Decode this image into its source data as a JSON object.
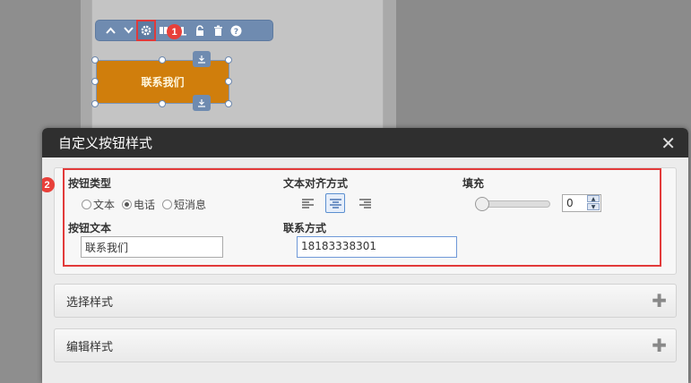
{
  "toolbar": {
    "icons": [
      "chevron-up-icon",
      "chevron-down-icon",
      "gear-icon",
      "layers-icon",
      "chart-icon",
      "unlock-icon",
      "trash-icon",
      "help-icon"
    ]
  },
  "markers": {
    "first": "1",
    "second": "2"
  },
  "canvas_button": {
    "label": "联系我们",
    "color": "#d07e0c"
  },
  "dialog": {
    "title": "自定义按钮样式",
    "button_type": {
      "label": "按钮类型",
      "options": [
        "文本",
        "电话",
        "短消息"
      ],
      "selected": "电话"
    },
    "text_align": {
      "label": "文本对齐方式",
      "selected": "center"
    },
    "fill": {
      "label": "填充",
      "value": "0"
    },
    "button_text": {
      "label": "按钮文本",
      "value": "联系我们"
    },
    "contact": {
      "label": "联系方式",
      "value": "18183338301"
    },
    "sections": [
      {
        "label": "选择样式"
      },
      {
        "label": "编辑样式"
      }
    ]
  },
  "colors": {
    "highlight": "#e23a3a",
    "toolbar": "#6f8bb0",
    "header": "#2f2f2f"
  }
}
